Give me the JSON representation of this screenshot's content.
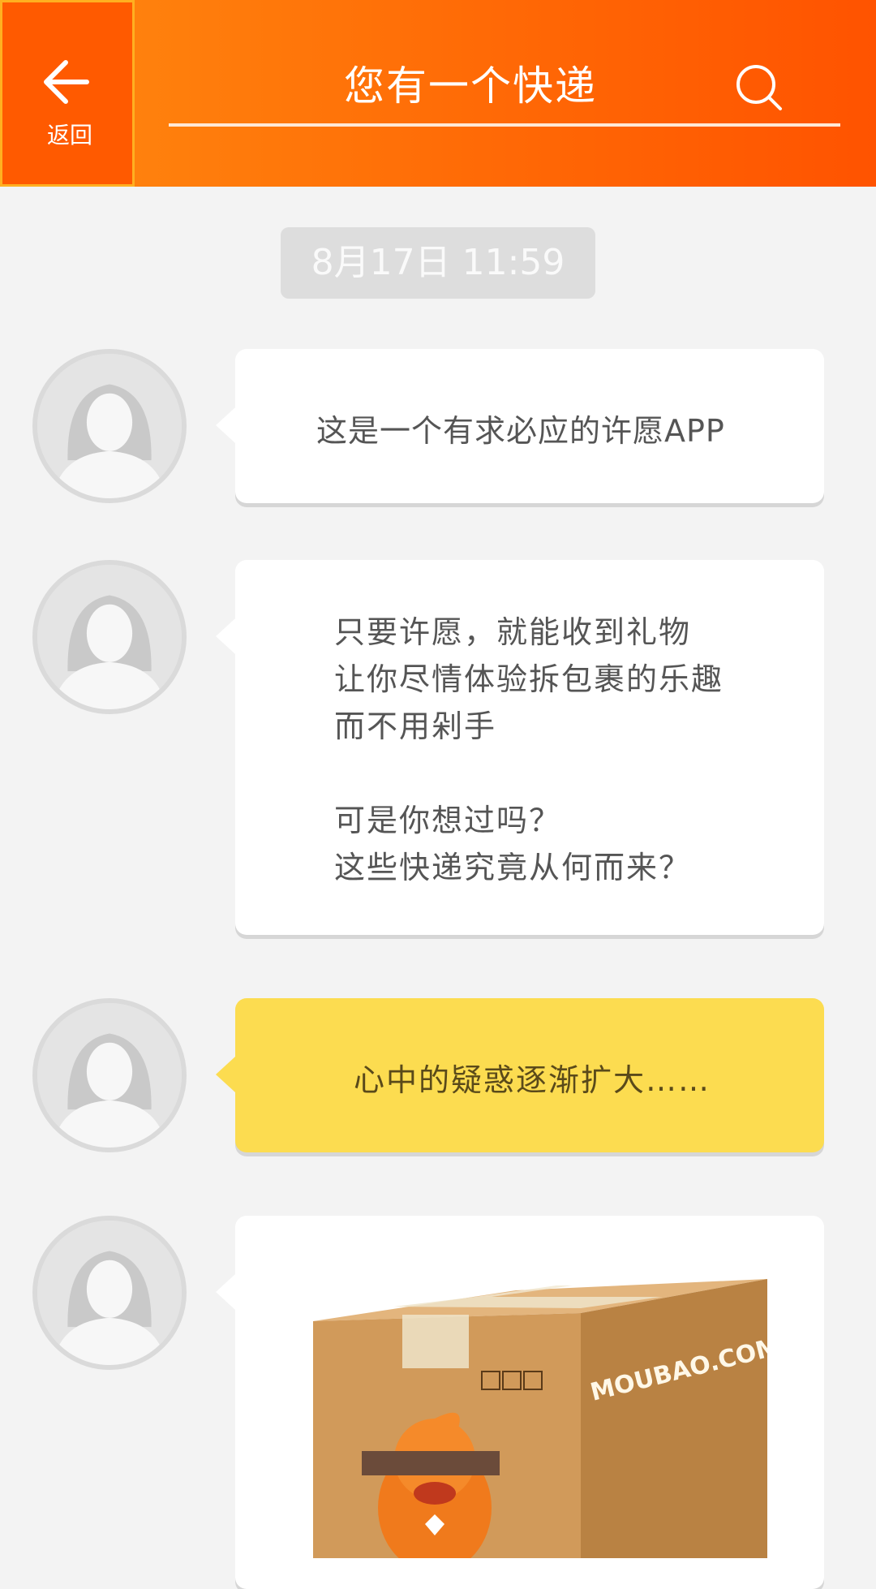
{
  "header": {
    "back_label": "返回",
    "title": "您有一个快递"
  },
  "chat": {
    "date": "8月17日 11:59",
    "messages": [
      {
        "type": "text",
        "text": "这是一个有求必应的许愿APP"
      },
      {
        "type": "text",
        "lines": [
          "只要许愿，就能收到礼物",
          "让你尽情体验拆包裹的乐趣",
          "而不用剁手",
          "",
          "可是你想过吗？",
          "这些快递究竟从何而来？"
        ]
      },
      {
        "type": "text",
        "highlight": true,
        "text": "心中的疑惑逐渐扩大……"
      },
      {
        "type": "image",
        "image_label": "MOUBAO.COM"
      }
    ]
  },
  "colors": {
    "header_orange": "#ff6a06",
    "highlight_yellow": "#fcdc50",
    "background": "#f3f3f3"
  }
}
